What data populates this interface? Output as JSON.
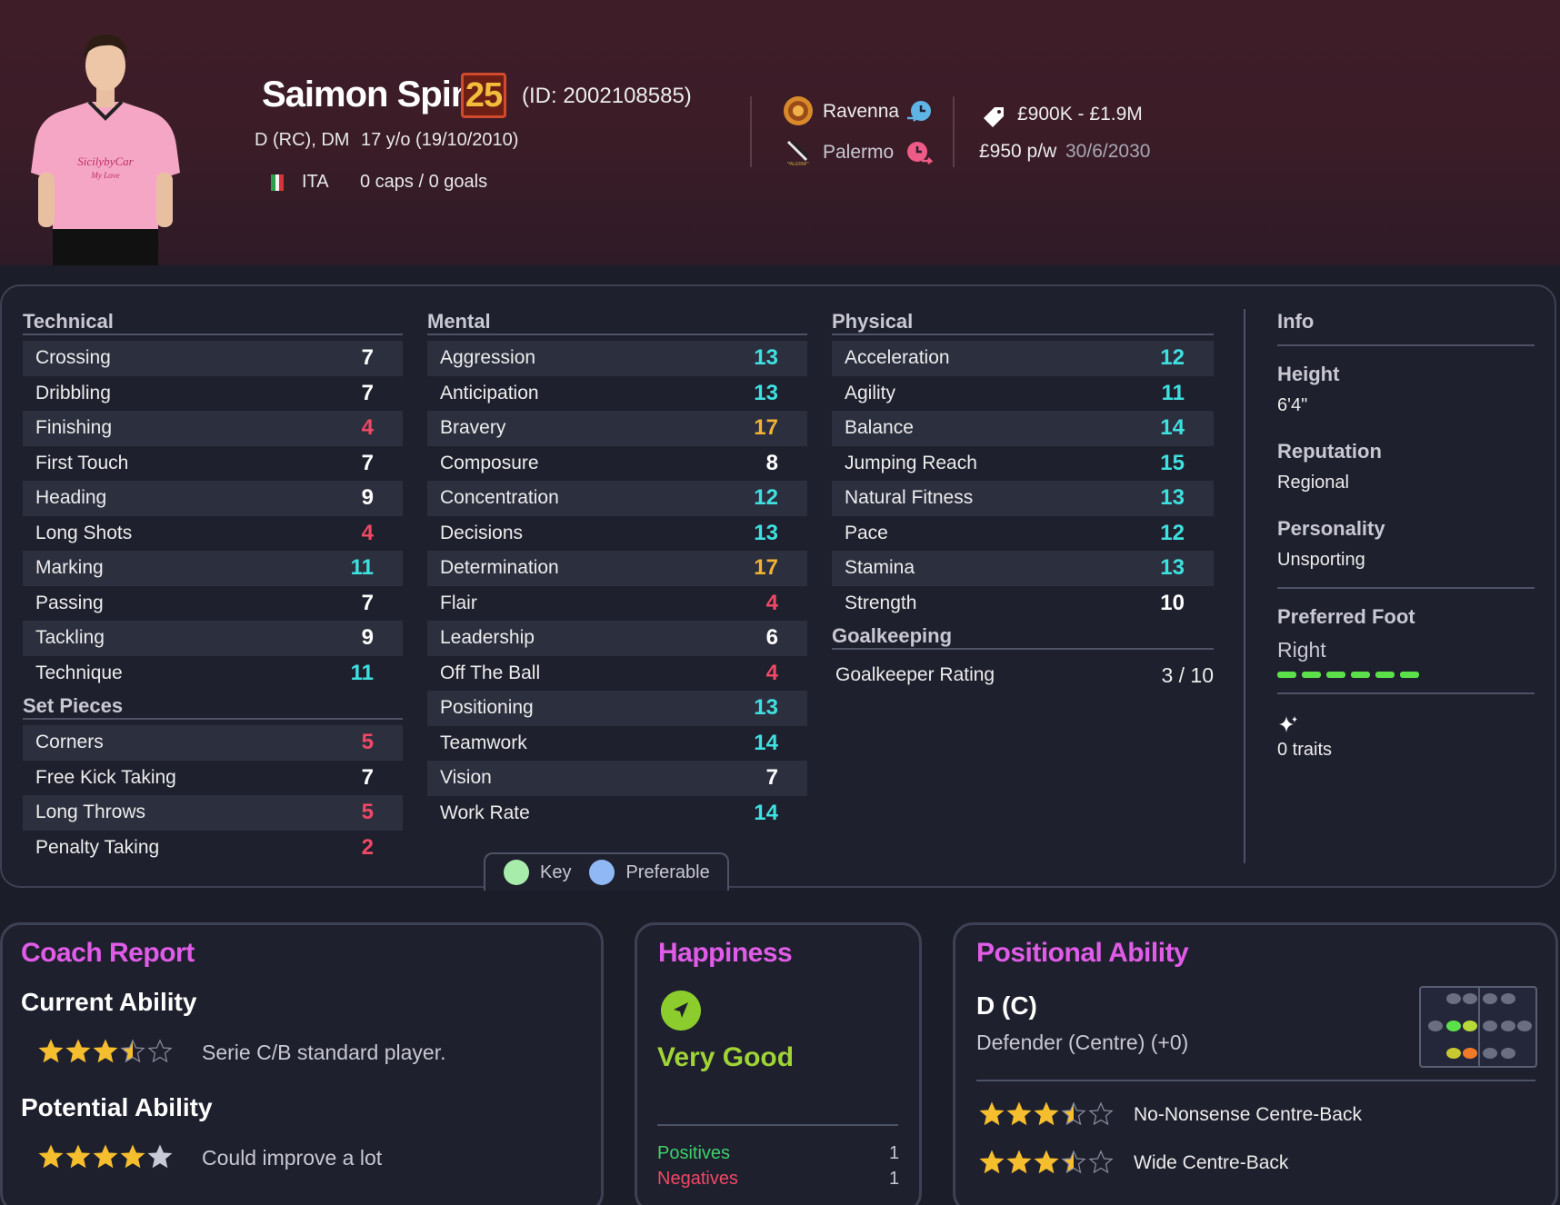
{
  "header": {
    "name": "Saimon Spina",
    "current_ability": "25",
    "player_id": "(ID: 2002108585)",
    "positions": "D (RC), DM",
    "age": "17 y/o (19/10/2010)",
    "nationality": "ITA",
    "caps": "0 caps / 0 goals",
    "club": "Ravenna",
    "parent_club": "Palermo",
    "value": "£900K - £1.9M",
    "wage": "£950 p/w",
    "contract_end": "30/6/2030",
    "shirt_text": "SicilybyCar",
    "shirt_subtext": "My Love"
  },
  "technical": {
    "title": "Technical",
    "rows": [
      {
        "label": "Crossing",
        "value": "7",
        "color": "white"
      },
      {
        "label": "Dribbling",
        "value": "7",
        "color": "white"
      },
      {
        "label": "Finishing",
        "value": "4",
        "color": "red"
      },
      {
        "label": "First Touch",
        "value": "7",
        "color": "white"
      },
      {
        "label": "Heading",
        "value": "9",
        "color": "white"
      },
      {
        "label": "Long Shots",
        "value": "4",
        "color": "red"
      },
      {
        "label": "Marking",
        "value": "11",
        "color": "cyan"
      },
      {
        "label": "Passing",
        "value": "7",
        "color": "white"
      },
      {
        "label": "Tackling",
        "value": "9",
        "color": "white"
      },
      {
        "label": "Technique",
        "value": "11",
        "color": "cyan"
      }
    ]
  },
  "set_pieces": {
    "title": "Set Pieces",
    "rows": [
      {
        "label": "Corners",
        "value": "5",
        "color": "red"
      },
      {
        "label": "Free Kick Taking",
        "value": "7",
        "color": "white"
      },
      {
        "label": "Long Throws",
        "value": "5",
        "color": "red"
      },
      {
        "label": "Penalty Taking",
        "value": "2",
        "color": "red"
      }
    ]
  },
  "mental": {
    "title": "Mental",
    "rows": [
      {
        "label": "Aggression",
        "value": "13",
        "color": "cyan"
      },
      {
        "label": "Anticipation",
        "value": "13",
        "color": "cyan"
      },
      {
        "label": "Bravery",
        "value": "17",
        "color": "yellow"
      },
      {
        "label": "Composure",
        "value": "8",
        "color": "white"
      },
      {
        "label": "Concentration",
        "value": "12",
        "color": "cyan"
      },
      {
        "label": "Decisions",
        "value": "13",
        "color": "cyan"
      },
      {
        "label": "Determination",
        "value": "17",
        "color": "yellow"
      },
      {
        "label": "Flair",
        "value": "4",
        "color": "red"
      },
      {
        "label": "Leadership",
        "value": "6",
        "color": "white"
      },
      {
        "label": "Off The Ball",
        "value": "4",
        "color": "red"
      },
      {
        "label": "Positioning",
        "value": "13",
        "color": "cyan"
      },
      {
        "label": "Teamwork",
        "value": "14",
        "color": "cyan"
      },
      {
        "label": "Vision",
        "value": "7",
        "color": "white"
      },
      {
        "label": "Work Rate",
        "value": "14",
        "color": "cyan"
      }
    ]
  },
  "physical": {
    "title": "Physical",
    "rows": [
      {
        "label": "Acceleration",
        "value": "12",
        "color": "cyan"
      },
      {
        "label": "Agility",
        "value": "11",
        "color": "cyan"
      },
      {
        "label": "Balance",
        "value": "14",
        "color": "cyan"
      },
      {
        "label": "Jumping Reach",
        "value": "15",
        "color": "cyan"
      },
      {
        "label": "Natural Fitness",
        "value": "13",
        "color": "cyan"
      },
      {
        "label": "Pace",
        "value": "12",
        "color": "cyan"
      },
      {
        "label": "Stamina",
        "value": "13",
        "color": "cyan"
      },
      {
        "label": "Strength",
        "value": "10",
        "color": "white"
      }
    ]
  },
  "goalkeeping": {
    "title": "Goalkeeping",
    "rating_label": "Goalkeeper Rating",
    "rating_value": "3 / 10"
  },
  "info": {
    "title": "Info",
    "height_label": "Height",
    "height": "6'4\"",
    "reputation_label": "Reputation",
    "reputation": "Regional",
    "personality_label": "Personality",
    "personality": "Unsporting",
    "foot_label": "Preferred Foot",
    "foot": "Right",
    "foot_level_segments": 6,
    "traits": "0 traits"
  },
  "legend": {
    "key_label": "Key",
    "key_color": "#a8ecab",
    "preferable_label": "Preferable",
    "preferable_color": "#8fb8f5"
  },
  "coach_report": {
    "title": "Coach Report",
    "current_label": "Current Ability",
    "current_stars": 3.5,
    "current_text": "Serie C/B standard player.",
    "potential_label": "Potential Ability",
    "potential_stars": 5,
    "potential_text": "Could improve a lot"
  },
  "happiness": {
    "title": "Happiness",
    "status": "Very Good",
    "positives_label": "Positives",
    "positives_count": "1",
    "negatives_label": "Negatives",
    "negatives_count": "1"
  },
  "positional": {
    "title": "Positional Ability",
    "position": "D (C)",
    "position_desc": "Defender (Centre) (+0)",
    "roles": [
      {
        "name": "No-Nonsense Centre-Back",
        "stars": 3.5
      },
      {
        "name": "Wide Centre-Back",
        "stars": 3.5
      }
    ]
  },
  "colors": {
    "accent_title": "#e05ce8",
    "attr_white": "#ffffff",
    "attr_cyan": "#3fe0e0",
    "attr_red": "#f04865",
    "attr_yellow": "#f2b233",
    "star": "#f5be2e",
    "positives": "#3ed06c",
    "negatives": "#f04865"
  }
}
